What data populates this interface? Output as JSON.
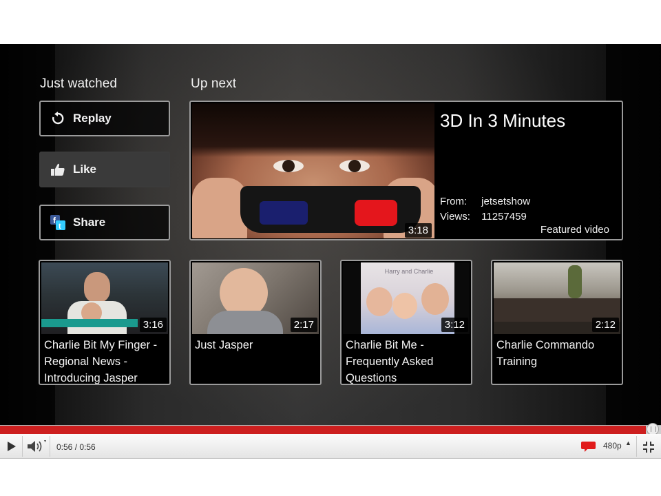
{
  "end_screen": {
    "just_watched_label": "Just watched",
    "up_next_label": "Up next",
    "actions": {
      "replay": "Replay",
      "like": "Like",
      "share": "Share"
    },
    "featured": {
      "title": "3D In 3 Minutes",
      "from_label": "From:",
      "from_value": "jetsetshow",
      "views_label": "Views:",
      "views_value": "11257459",
      "tag": "Featured video",
      "duration": "3:18"
    },
    "related": [
      {
        "title": "Charlie Bit My Finger - Regional News  - Introducing Jasper",
        "duration": "3:16"
      },
      {
        "title": "Just Jasper",
        "duration": "2:17"
      },
      {
        "title": "Charlie Bit Me - Frequently Asked Questions",
        "duration": "3:12",
        "thumb_text": "Harry and Charlie"
      },
      {
        "title": "Charlie Commando Training",
        "duration": "2:12"
      }
    ]
  },
  "player": {
    "time": "0:56 / 0:56",
    "quality": "480p",
    "progress": 1.0,
    "colors": {
      "progress": "#cd1f1f",
      "cc": "#e11b1b"
    }
  },
  "icons": [
    "replay-icon",
    "thumbs-up-icon",
    "share-icon",
    "play-icon",
    "volume-icon",
    "captions-icon",
    "fullscreen-exit-icon"
  ]
}
